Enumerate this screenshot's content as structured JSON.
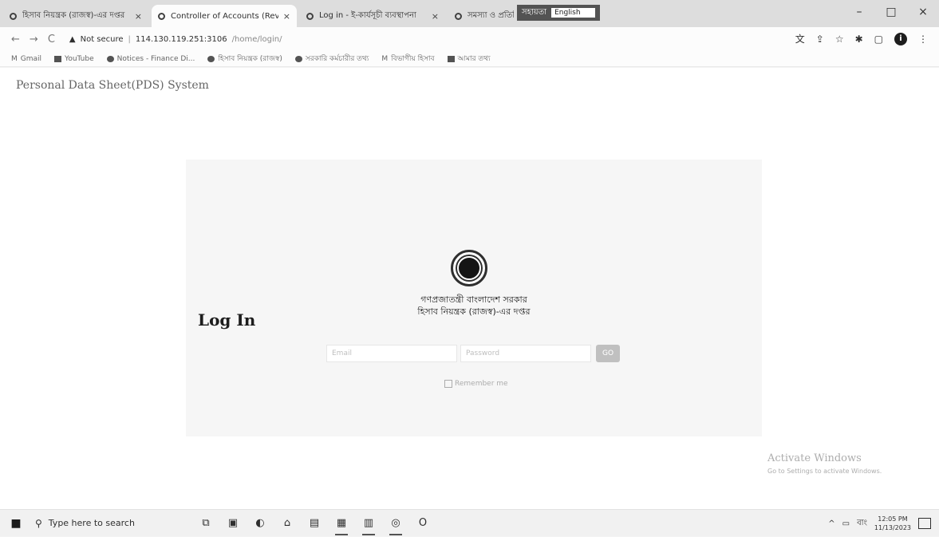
{
  "browser": {
    "tabs": [
      {
        "title": "হিসাব নিয়ন্ত্রক (রাজস্ব)-এর দপ্তর",
        "active": false
      },
      {
        "title": "Controller of Accounts (Revenue",
        "active": true
      },
      {
        "title": "Log in - ই-কার্যসূচী ব্যবস্থাপনা",
        "active": false
      },
      {
        "title": "সমস্যা ও প্রতিক্রিয়া",
        "active": false
      }
    ],
    "close_glyph": "×",
    "ime": {
      "label": "সহায়তা",
      "language": "English"
    },
    "window_controls": {
      "minimize": "–",
      "maximize": "□",
      "close": "×"
    },
    "nav": {
      "back": "←",
      "forward": "→",
      "reload": "C"
    },
    "address": {
      "warning": "Not secure",
      "host": "114.130.119.251:3106",
      "path": "/home/login/"
    },
    "toolbar_icons": [
      "translate-icon",
      "share-icon",
      "star-icon",
      "extensions-icon",
      "sidepanel-icon",
      "profile-icon"
    ],
    "toolbar_glyphs": [
      "文",
      "⇪",
      "☆",
      "✱",
      "▢"
    ],
    "profile_initial": "i",
    "bookmarks": [
      "Gmail",
      "YouTube",
      "Notices - Finance Di...",
      "হিসাব নিয়ন্ত্রক (রাজস্ব)",
      "সরকারি কর্মচারীর তথ্য",
      "বিভাগীয় হিসাব",
      "আমার তথ্য"
    ]
  },
  "page": {
    "brand": "Personal Data Sheet(PDS) System",
    "gov_line1": "গণপ্রজাতন্ত্রী বাংলাদেশ সরকার",
    "gov_line2": "হিসাব নিয়ন্ত্রক (রাজস্ব)-এর দপ্তর",
    "login_title": "Log In",
    "email_placeholder": "Email",
    "password_placeholder": "Password",
    "go_label": "GO",
    "remember_label": "Remember me",
    "activate_title": "Activate Windows",
    "activate_sub": "Go to Settings to activate Windows."
  },
  "taskbar": {
    "start_glyph": "■",
    "search_placeholder": "Type here to search",
    "apps": [
      "task-view-icon",
      "file-explorer-icon",
      "edge-icon",
      "store-icon",
      "mail-icon",
      "photos-icon",
      "word-icon",
      "chrome-icon",
      "opera-icon"
    ],
    "app_glyphs": [
      "⧉",
      "▣",
      "◐",
      "⌂",
      "▤",
      "▦",
      "▥",
      "◎",
      "O"
    ],
    "tray": {
      "chevron": "^",
      "network": "▭",
      "lang": "বাং",
      "time": "12:05 PM",
      "date": "11/13/2023"
    }
  }
}
